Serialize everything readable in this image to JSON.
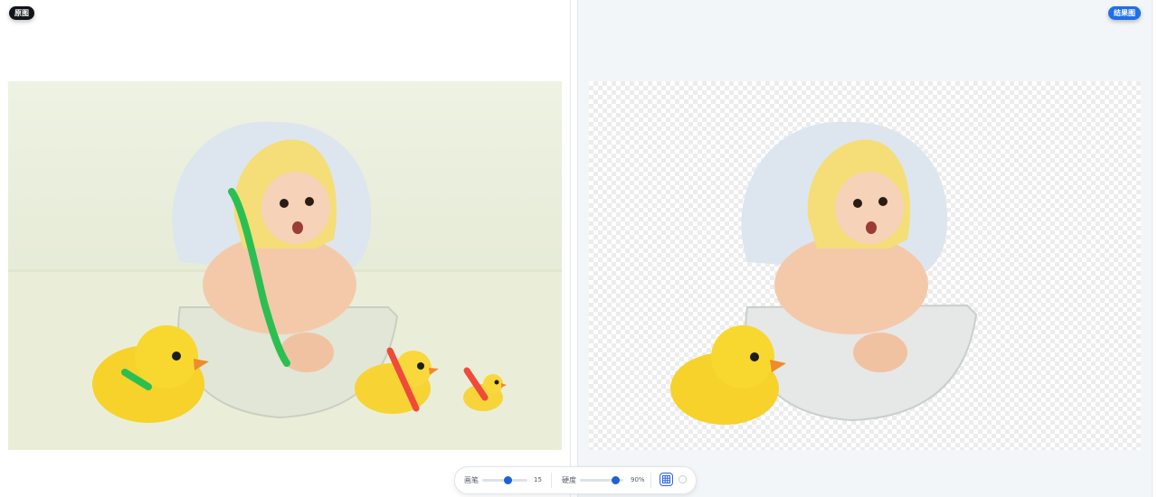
{
  "header": {
    "original_label": "原图",
    "result_label": "结果图"
  },
  "images": {
    "original": "baby-in-bathtub-with-rubber-ducks-photo",
    "result": "cutout-baby-bathtub-duck-transparent"
  },
  "brush_strokes": {
    "keep_color": "#2bbf52",
    "remove_color": "#f04a3a"
  },
  "toolbar": {
    "brush_label": "画笔",
    "brush_value": "15",
    "brush_level": 0.6,
    "hardness_label": "硬度",
    "hardness_value": "90%",
    "hardness_level": 0.9
  },
  "colors": {
    "accent": "#1f5fd8",
    "result_badge": "#1f6fe8",
    "original_badge": "#111418"
  }
}
